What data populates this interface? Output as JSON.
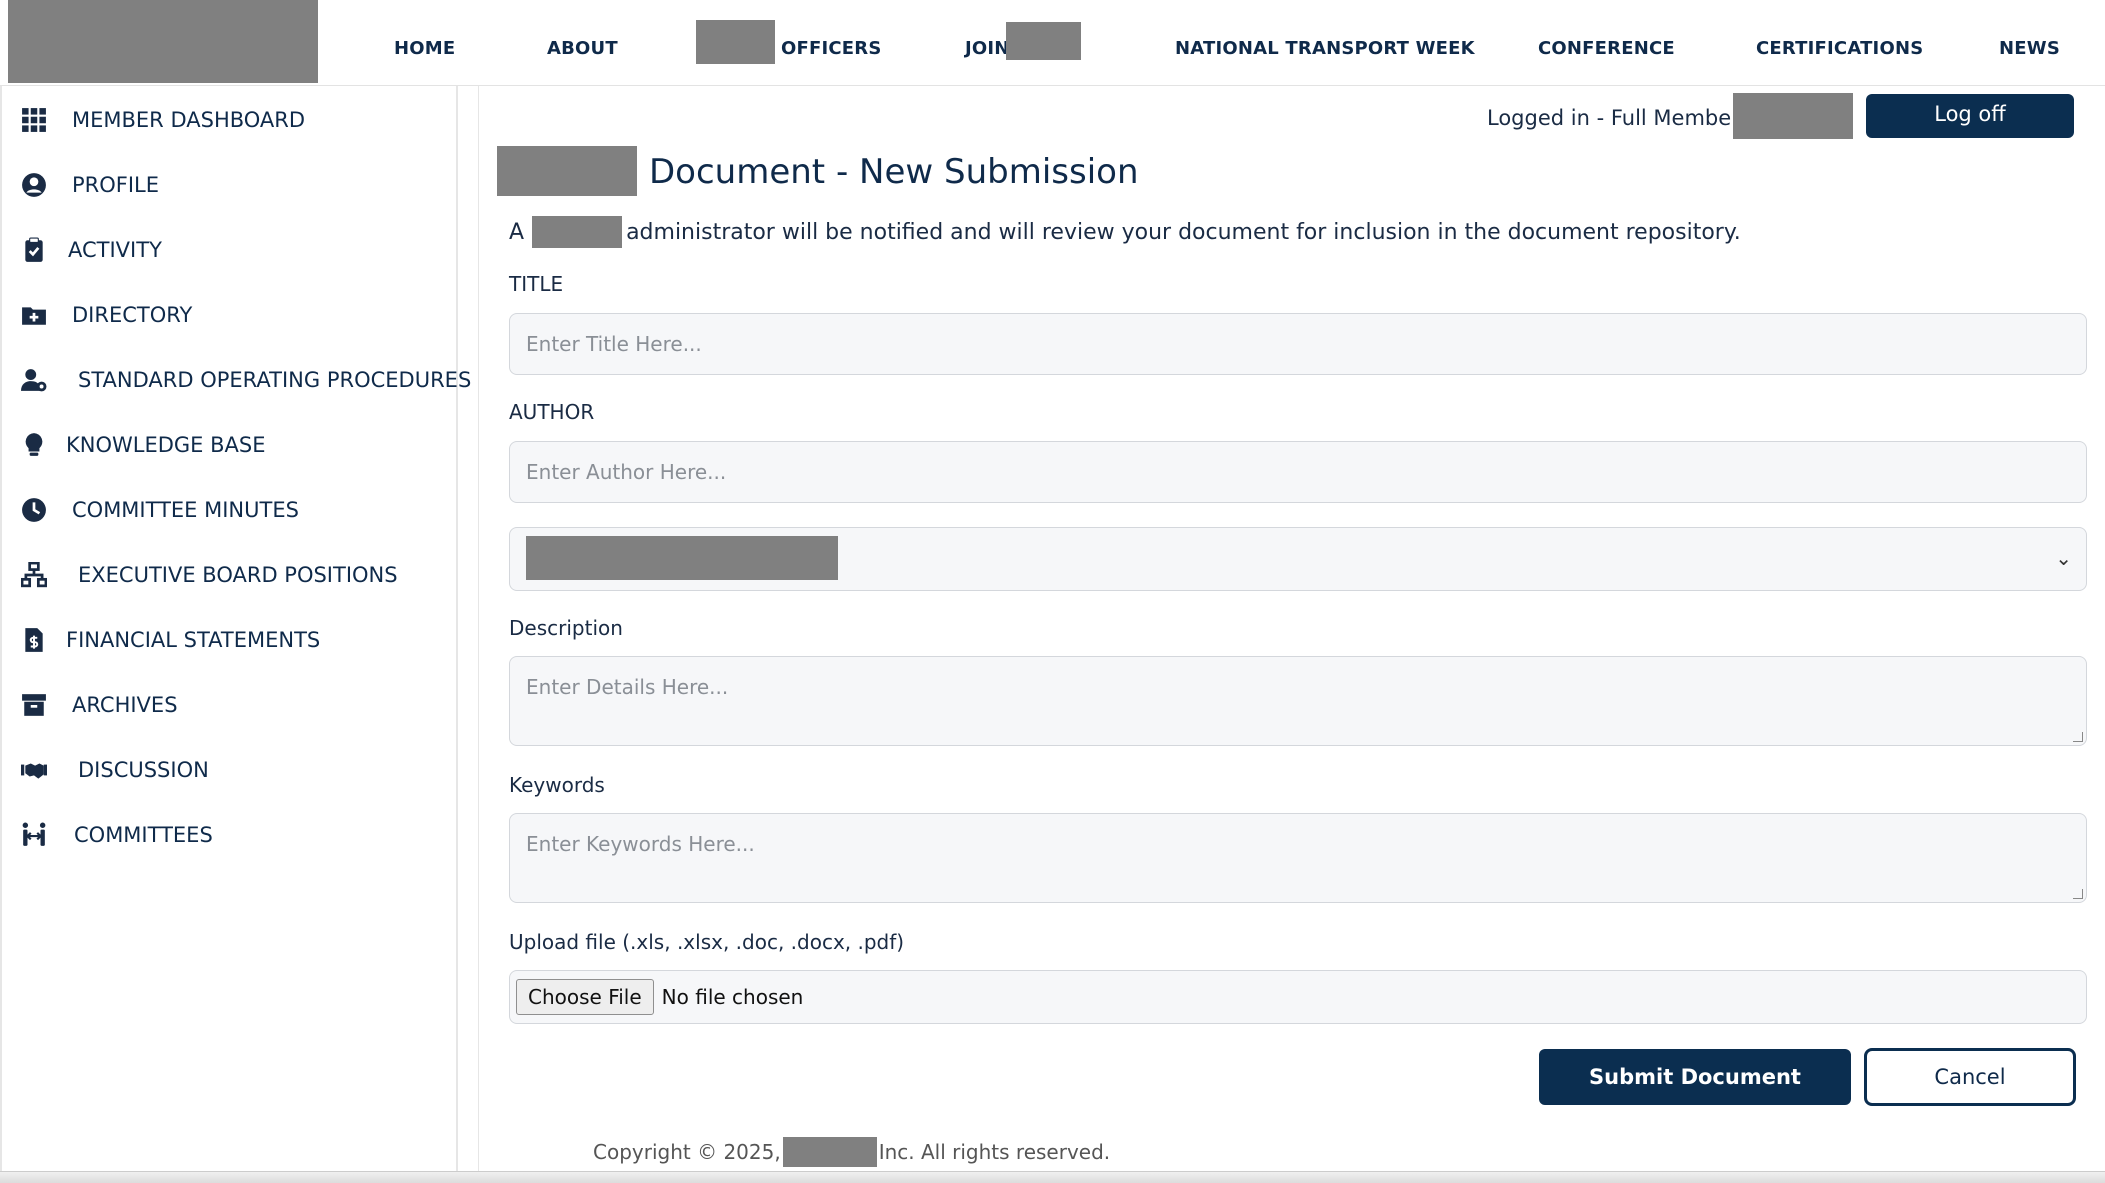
{
  "nav": {
    "home": "HOME",
    "about": "ABOUT",
    "officers": "OFFICERS",
    "join": "JOIN",
    "ntw": "NATIONAL TRANSPORT WEEK",
    "conference": "CONFERENCE",
    "certifications": "CERTIFICATIONS",
    "news": "NEWS"
  },
  "sidebar": {
    "items": [
      {
        "label": "MEMBER DASHBOARD",
        "icon": "grid-icon"
      },
      {
        "label": "PROFILE",
        "icon": "user-circle-icon"
      },
      {
        "label": "ACTIVITY",
        "icon": "clipboard-check-icon"
      },
      {
        "label": "DIRECTORY",
        "icon": "folder-plus-icon"
      },
      {
        "label": "STANDARD OPERATING PROCEDURES",
        "icon": "user-gear-icon"
      },
      {
        "label": "KNOWLEDGE BASE",
        "icon": "lightbulb-icon"
      },
      {
        "label": "COMMITTEE MINUTES",
        "icon": "clock-icon"
      },
      {
        "label": "EXECUTIVE BOARD POSITIONS",
        "icon": "sitemap-icon"
      },
      {
        "label": "FINANCIAL STATEMENTS",
        "icon": "invoice-dollar-icon"
      },
      {
        "label": "ARCHIVES",
        "icon": "archive-box-icon"
      },
      {
        "label": "DISCUSSION",
        "icon": "handshake-icon"
      },
      {
        "label": "COMMITTEES",
        "icon": "people-arrows-icon"
      }
    ]
  },
  "header": {
    "login_status": "Logged in - Full Member :",
    "logoff_label": "Log off"
  },
  "page": {
    "title": "Document - New Submission",
    "intro_prefix": "A",
    "intro_suffix": "administrator will be notified and will review your document for inclusion in the document repository."
  },
  "form": {
    "title_label": "TITLE",
    "title_placeholder": "Enter Title Here...",
    "author_label": "AUTHOR",
    "author_placeholder": "Enter Author Here...",
    "description_label": "Description",
    "description_placeholder": "Enter Details Here...",
    "keywords_label": "Keywords",
    "keywords_placeholder": "Enter Keywords Here...",
    "upload_label": "Upload file (.xls, .xlsx, .doc, .docx, .pdf)",
    "choose_file_label": "Choose File",
    "no_file_label": "No file chosen",
    "submit_label": "Submit Document",
    "cancel_label": "Cancel"
  },
  "footer": {
    "copyright_prefix": "Copyright © 2025,",
    "copyright_suffix": "Inc. All rights reserved."
  },
  "colors": {
    "primary": "#0b2e50",
    "text": "#1a2b44",
    "field_bg": "#f6f7f9",
    "redaction": "#808080"
  }
}
